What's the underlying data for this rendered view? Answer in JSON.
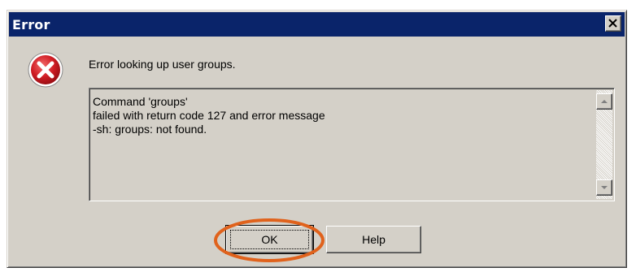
{
  "window": {
    "title": "Error",
    "close_icon": "close-icon",
    "titlebar_color": "#0a246a",
    "face_color": "#d4d0c8"
  },
  "dialog": {
    "icon": "error-icon",
    "icon_color": "#c8141e",
    "message": "Error looking up user groups.",
    "details": [
      "Command 'groups'",
      "failed with return code 127 and error message",
      "-sh: groups: not found."
    ]
  },
  "buttons": {
    "ok_label": "OK",
    "help_label": "Help"
  },
  "annotation": {
    "highlight": "ok-button",
    "highlight_color": "#e0621c"
  }
}
